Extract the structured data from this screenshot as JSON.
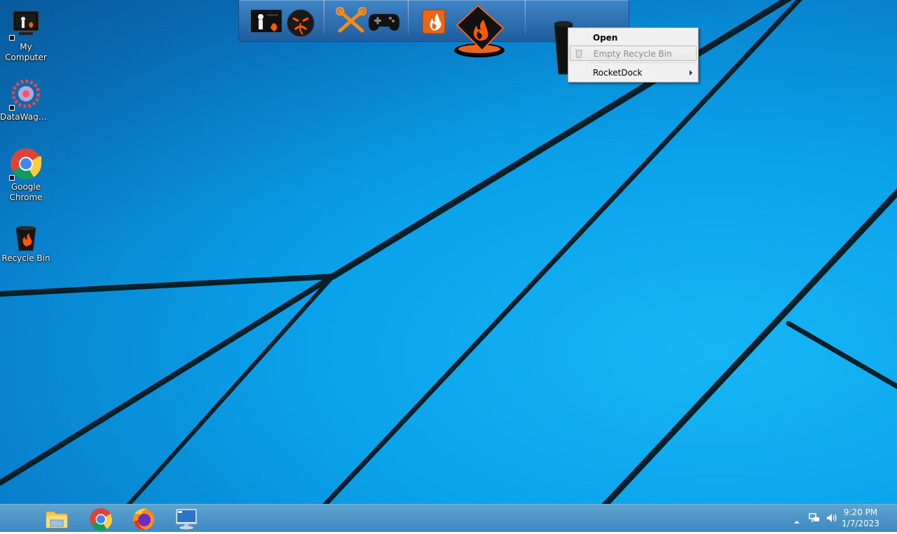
{
  "desktop_icons": [
    {
      "name": "my-computer",
      "label": "My Computer"
    },
    {
      "name": "datawagon",
      "label": "DataWagon..."
    },
    {
      "name": "google-chrome",
      "label": "Google Chrome"
    },
    {
      "name": "recycle-bin",
      "label": "Recycle Bin"
    }
  ],
  "dock": {
    "items": [
      {
        "name": "dock-my-computer",
        "icon": "computer-flame-icon"
      },
      {
        "name": "dock-zone",
        "icon": "demon-face-icon"
      },
      {
        "name": "dock-tools",
        "icon": "crossed-wrenches-icon"
      },
      {
        "name": "dock-games",
        "icon": "gamepad-icon"
      },
      {
        "name": "dock-documents",
        "icon": "flame-document-icon"
      },
      {
        "name": "dock-folder",
        "icon": "flame-folder-icon"
      },
      {
        "name": "dock-recycle-bin",
        "icon": "recycle-bin-icon"
      }
    ]
  },
  "context_menu": {
    "open": "Open",
    "empty_recycle_bin": "Empty Recycle Bin",
    "rocketdock": "RocketDock"
  },
  "taskbar": {
    "apps": [
      {
        "name": "file-explorer",
        "icon": "folder-icon"
      },
      {
        "name": "chrome",
        "icon": "chrome-icon"
      },
      {
        "name": "firefox",
        "icon": "firefox-icon"
      },
      {
        "name": "remote-desktop",
        "icon": "monitor-icon"
      }
    ],
    "clock": {
      "time": "9:20 PM",
      "date": "1/7/2023"
    }
  },
  "colors": {
    "accent": "#0aa2ea",
    "flame": "#ff5a00",
    "taskbar": "#3a8cc8"
  }
}
